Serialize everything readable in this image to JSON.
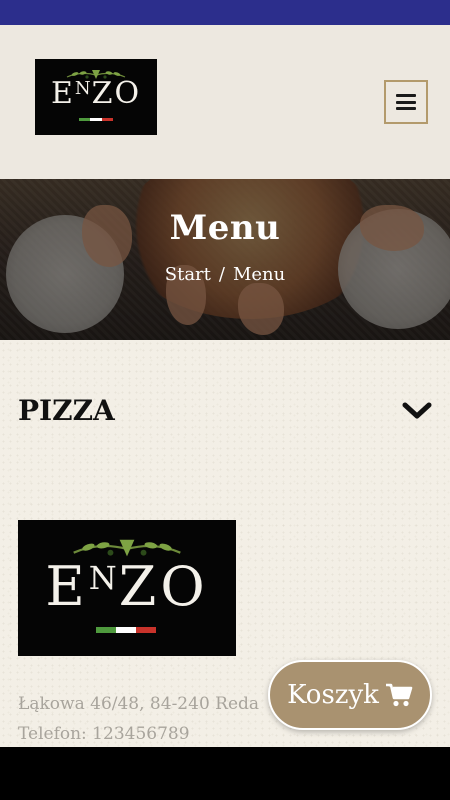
{
  "header": {
    "logo_text": "ENZO",
    "menu_icon": "hamburger-icon"
  },
  "hero": {
    "title": "Menu",
    "breadcrumb": {
      "home": "Start",
      "separator": "/",
      "current": "Menu"
    }
  },
  "menu": {
    "categories": [
      {
        "name": "PIZZA",
        "icon": "chevron-down-icon",
        "expanded": false
      }
    ]
  },
  "footer": {
    "logo_text": "ENZO",
    "address": "Łąkowa 46/48, 84-240 Reda",
    "phone": "Telefon: 123456789"
  },
  "cart": {
    "label": "Koszyk",
    "icon": "cart-icon"
  },
  "colors": {
    "status_bar": "#2c2e8c",
    "header_bg": "#ede8e0",
    "accent": "#a99270",
    "menu_button_border": "#b39a6c",
    "flag_green": "#4f9a3e",
    "flag_white": "#ffffff",
    "flag_red": "#c9332b"
  }
}
